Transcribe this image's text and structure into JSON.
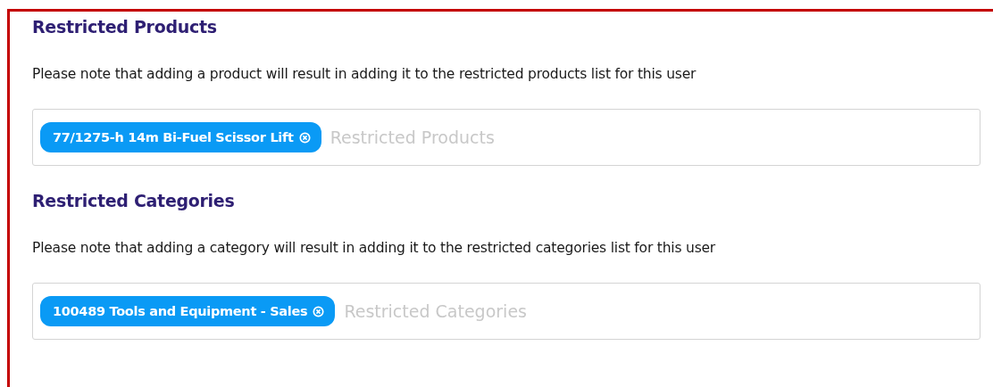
{
  "sections": [
    {
      "title": "Restricted Products",
      "note": "Please note that adding a product will result in adding it to the restricted products list for this user",
      "field": {
        "placeholder": "Restricted Products",
        "tags": [
          {
            "label": "77/1275-h 14m Bi-Fuel Scissor Lift"
          }
        ]
      }
    },
    {
      "title": "Restricted Categories",
      "note": "Please note that adding a category will result in adding it to the restricted categories list for this user",
      "field": {
        "placeholder": "Restricted Categories",
        "tags": [
          {
            "label": "100489 Tools and Equipment - Sales"
          }
        ]
      }
    }
  ]
}
